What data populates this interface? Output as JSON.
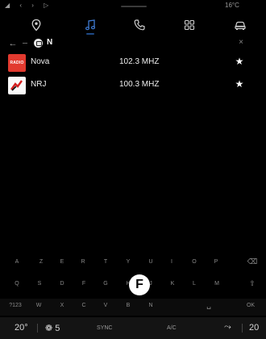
{
  "status": {
    "left_icons": "◢ ‹ › ▷",
    "temp": "16°C",
    "temp_short": "20"
  },
  "nav": [
    {
      "icon": "location-pin-icon"
    },
    {
      "icon": "music-note-icon",
      "active": true
    },
    {
      "icon": "phone-icon"
    },
    {
      "icon": "apps-grid-icon"
    },
    {
      "icon": "car-icon"
    }
  ],
  "search": {
    "query": "N",
    "back_symbol": "←",
    "close_symbol": "×",
    "source_icon": "radio-icon"
  },
  "stations": [
    {
      "name": "Nova",
      "frequency": "102.3 MHZ",
      "logo_text": "RADIO",
      "favorite": "★"
    },
    {
      "name": "NRJ",
      "frequency": "100.3 MHZ",
      "logo_text": "",
      "favorite": "★"
    }
  ],
  "keyboard": {
    "row1": [
      "A",
      "Z",
      "E",
      "R",
      "T",
      "Y",
      "U",
      "I",
      "O",
      "P",
      "⌫"
    ],
    "row2": [
      "Q",
      "S",
      "D",
      "F",
      "G",
      "H",
      "J",
      "K",
      "L",
      "M",
      "⇧"
    ],
    "row3": [
      "?123",
      "W",
      "X",
      "C",
      "V",
      "B",
      "N",
      "",
      "␣",
      "OK"
    ]
  },
  "callout": "F",
  "climate": {
    "temp_left": "20°",
    "fan": "❁ 5",
    "sync": "SYNC",
    "ac": "A/C",
    "seat": "⤳",
    "temp_right": "20"
  },
  "colors": {
    "accent": "#1f4a86",
    "nova_red": "#e23a2f",
    "background": "#000000"
  }
}
